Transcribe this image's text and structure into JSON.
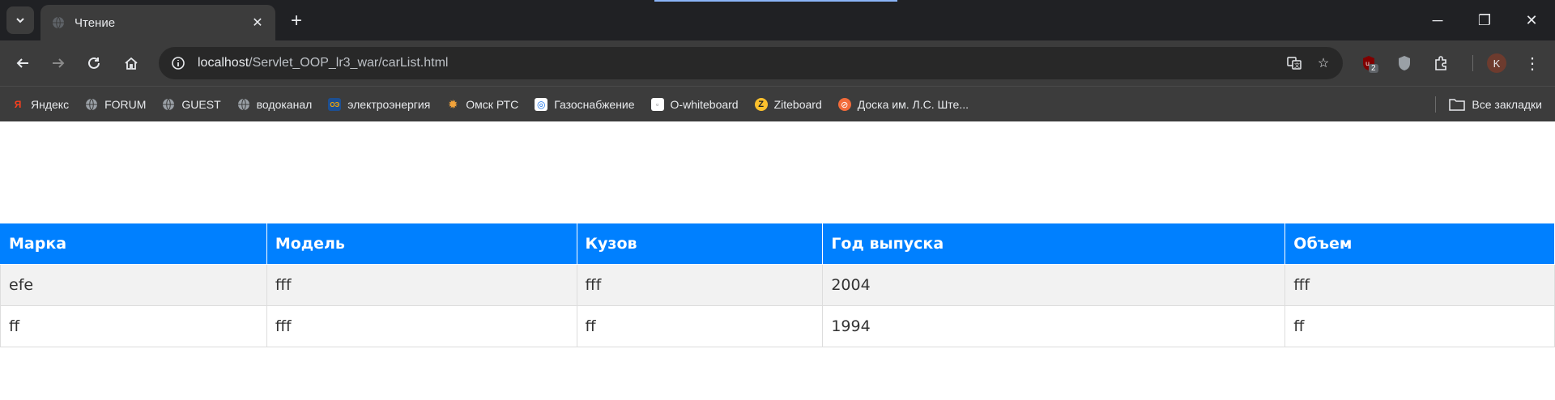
{
  "browser": {
    "tab_title": "Чтение",
    "url_host": "localhost",
    "url_path": "/Servlet_OOP_lr3_war/carList.html",
    "extension_badge": "2",
    "profile_initial": "K",
    "bookmarks": [
      {
        "label": "Яндекс",
        "icon": "yandex-icon"
      },
      {
        "label": "FORUM",
        "icon": "globe-icon"
      },
      {
        "label": "GUEST",
        "icon": "globe-icon"
      },
      {
        "label": "водоканал",
        "icon": "globe-icon"
      },
      {
        "label": "электроэнергия",
        "icon": "omsk-energy-icon"
      },
      {
        "label": "Омск РТС",
        "icon": "sun-icon"
      },
      {
        "label": "Газоснабжение",
        "icon": "gas-icon"
      },
      {
        "label": "O-whiteboard",
        "icon": "whiteboard-icon"
      },
      {
        "label": "Ziteboard",
        "icon": "ziteboard-icon"
      },
      {
        "label": "Доска им. Л.С. Ште...",
        "icon": "board-icon"
      }
    ],
    "all_bookmarks_label": "Все закладки"
  },
  "table": {
    "headers": [
      "Марка",
      "Модель",
      "Кузов",
      "Год выпуска",
      "Объем"
    ],
    "rows": [
      [
        "efe",
        "fff",
        "fff",
        "2004",
        "fff"
      ],
      [
        "ff",
        "fff",
        "ff",
        "1994",
        "ff"
      ]
    ]
  },
  "colors": {
    "header_bg": "#0080ff",
    "row_alt_bg": "#f2f2f2",
    "chrome_dark": "#202124",
    "toolbar": "#3c3c3c"
  }
}
